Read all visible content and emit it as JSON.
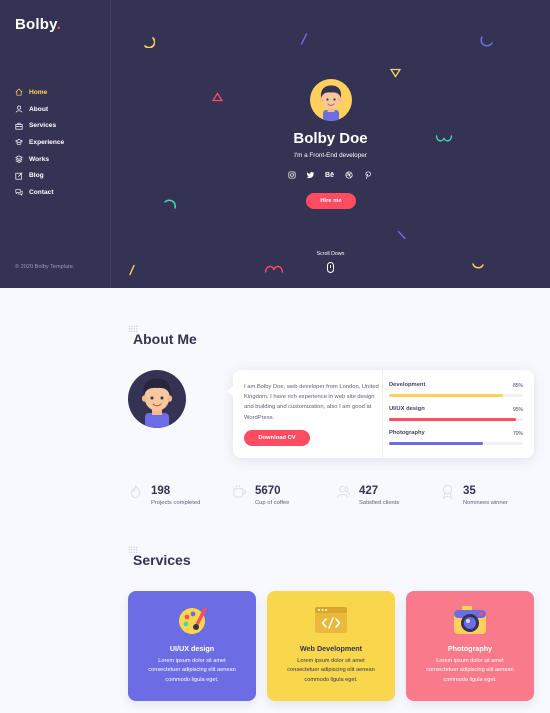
{
  "brand": {
    "name": "Bolby",
    "dot": "."
  },
  "nav": {
    "items": [
      {
        "label": "Home",
        "icon": "home-icon",
        "active": true
      },
      {
        "label": "About",
        "icon": "user-icon",
        "active": false
      },
      {
        "label": "Services",
        "icon": "briefcase-icon",
        "active": false
      },
      {
        "label": "Experience",
        "icon": "graduation-icon",
        "active": false
      },
      {
        "label": "Works",
        "icon": "layers-icon",
        "active": false
      },
      {
        "label": "Blog",
        "icon": "note-icon",
        "active": false
      },
      {
        "label": "Contact",
        "icon": "bubbles-icon",
        "active": false
      }
    ]
  },
  "copyright": "© 2020 Bolby Template.",
  "hero": {
    "name": "Bolby Doe",
    "subtitle": "I'm a Front-End developer",
    "social": [
      "instagram-icon",
      "twitter-icon",
      "behance-icon",
      "dribbble-icon",
      "pinterest-icon"
    ],
    "behance_text": "Bē",
    "hire_label": "Hire me",
    "scroll_label": "Scroll Down"
  },
  "about": {
    "title": "About Me",
    "text": "I am Bolby Doe, web developer from London, United Kingdom. I have rich experience in web site design and building and customization, also I am good at WordPress.",
    "download_label": "Download CV",
    "skills": [
      {
        "name": "Development",
        "value_label": "85%",
        "value": 0.85,
        "color": "#ffd15c"
      },
      {
        "name": "UI/UX design",
        "value_label": "95%",
        "value": 0.95,
        "color": "#ff4c60"
      },
      {
        "name": "Photography",
        "value_label": "70%",
        "value": 0.7,
        "color": "#6c6ce5"
      }
    ]
  },
  "stats": [
    {
      "number": "198",
      "label": "Projects completed",
      "icon": "fire-icon"
    },
    {
      "number": "5670",
      "label": "Cup of coffee",
      "icon": "cup-icon"
    },
    {
      "number": "427",
      "label": "Satisfied clients",
      "icon": "people-icon"
    },
    {
      "number": "35",
      "label": "Nominees winner",
      "icon": "badge-icon"
    }
  ],
  "services": {
    "title": "Services",
    "items": [
      {
        "title": "UI/UX design",
        "desc": "Lorem ipsum dolor sit amet consectetuer adipiscing elit aenean commodo ligula eget.",
        "icon": "palette-icon",
        "color": "#6c6ce5"
      },
      {
        "title": "Web Development",
        "desc": "Lorem ipsum dolor sit amet consectetuer adipiscing elit aenean commodo ligula eget.",
        "icon": "code-window-icon",
        "color": "#f9d74c"
      },
      {
        "title": "Photography",
        "desc": "Lorem ipsum dolor sit amet consectetuer adipiscing elit aenean commodo ligula eget.",
        "icon": "camera-icon",
        "color": "#f97b8b"
      }
    ]
  },
  "colors": {
    "dark": "#353353",
    "accent": "#ff4c60",
    "yellow": "#ffd15c",
    "blue": "#6c6ce5"
  }
}
